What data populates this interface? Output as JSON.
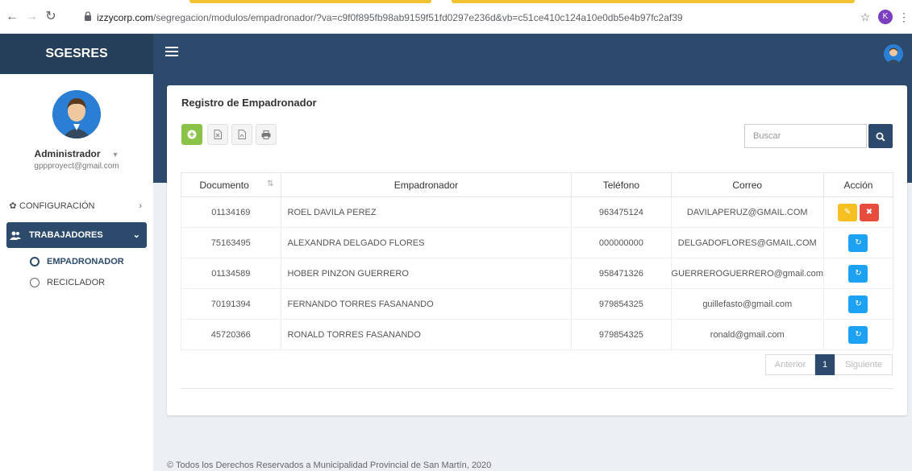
{
  "browser": {
    "url_host": "izzycorp.com",
    "url_path": "/segregacion/modulos/empadronador/?va=c9f0f895fb98ab9159f51fd0297e236d&vb=c51ce410c124a10e0db5e4b97fc2af39",
    "profile_initial": "K"
  },
  "header": {
    "brand": "SGESRES"
  },
  "sidebar": {
    "user_name": "Administrador",
    "user_email": "gppproyect@gmail.com",
    "items": [
      {
        "label": "CONFIGURACIÓN",
        "icon": "gear-icon"
      },
      {
        "label": "TRABAJADORES",
        "icon": "users-icon"
      }
    ],
    "subitems": [
      {
        "label": "EMPADRONADOR",
        "icon": "user-circle-icon"
      },
      {
        "label": "RECICLADOR",
        "icon": "user-circle-outline-icon"
      }
    ]
  },
  "card": {
    "title": "Registro de Empadronador",
    "search_placeholder": "Buscar"
  },
  "table": {
    "headers": [
      "Documento",
      "Empadronador",
      "Teléfono",
      "Correo",
      "Acción"
    ],
    "rows": [
      {
        "doc": "01134169",
        "name": "ROEL DAVILA PEREZ",
        "phone": "963475124",
        "email": "DAVILAPERUZ@GMAIL.COM",
        "actions": [
          "edit",
          "delete"
        ]
      },
      {
        "doc": "75163495",
        "name": "ALEXANDRA DELGADO FLORES",
        "phone": "000000000",
        "email": "DELGADOFLORES@GMAIL.COM",
        "actions": [
          "restore"
        ]
      },
      {
        "doc": "01134589",
        "name": "HOBER PINZON GUERRERO",
        "phone": "958471326",
        "email": "GUERREROGUERRERO@gmail.com",
        "actions": [
          "restore"
        ]
      },
      {
        "doc": "70191394",
        "name": "FERNANDO TORRES FASANANDO",
        "phone": "979854325",
        "email": "guillefasto@gmail.com",
        "actions": [
          "restore"
        ]
      },
      {
        "doc": "45720366",
        "name": "RONALD TORRES FASANANDO",
        "phone": "979854325",
        "email": "ronald@gmail.com",
        "actions": [
          "restore"
        ]
      }
    ]
  },
  "pagination": {
    "prev": "Anterior",
    "current": "1",
    "next": "Siguiente"
  },
  "footer": {
    "text": "© Todos los Derechos Reservados a Municipalidad Provincial de San Martín, 2020"
  },
  "colors": {
    "header": "#2c4a6b",
    "add_button": "#8bc34a",
    "edit_button": "#f6c023",
    "delete_button": "#e74c3c",
    "restore_button": "#1da1f2"
  }
}
